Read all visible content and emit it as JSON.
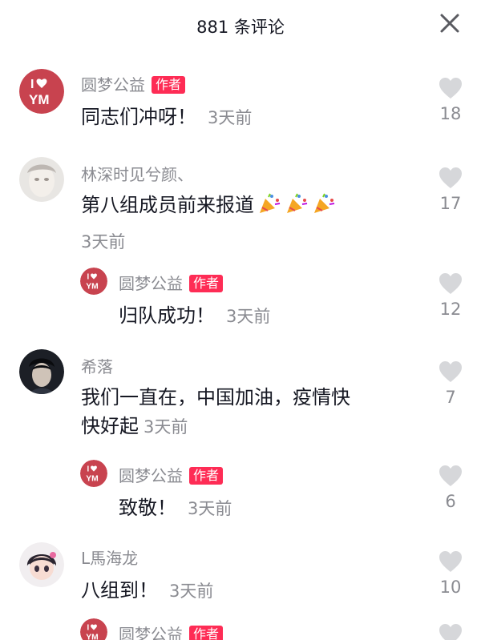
{
  "header": {
    "title": "881 条评论",
    "close_icon": "close-icon"
  },
  "author_tag": "作者",
  "comments": [
    {
      "user": "圆梦公益",
      "is_author": true,
      "text": "同志们冲呀！",
      "time": "3天前",
      "likes": "18"
    },
    {
      "user": "林深时见兮颜、",
      "is_author": false,
      "text": "第八组成员前来报道",
      "emojis": [
        "party-popper-icon",
        "party-popper-icon",
        "party-popper-icon"
      ],
      "time": "3天前",
      "likes": "17",
      "replies": [
        {
          "user": "圆梦公益",
          "is_author": true,
          "text": "归队成功！",
          "time": "3天前",
          "likes": "12"
        }
      ]
    },
    {
      "user": "希落",
      "is_author": false,
      "text_line1": "我们一直在，中国加油，疫情快",
      "text_line2": "快好起",
      "time": "3天前",
      "likes": "7",
      "replies": [
        {
          "user": "圆梦公益",
          "is_author": true,
          "text": "致敬！",
          "time": "3天前",
          "likes": "6"
        }
      ]
    },
    {
      "user": "L馬海龙",
      "is_author": false,
      "text": "八组到！",
      "time": "3天前",
      "likes": "10",
      "replies": [
        {
          "user": "圆梦公益",
          "is_author": true
        }
      ]
    }
  ],
  "colors": {
    "accent": "#fe2c55",
    "muted": "#8a8b91",
    "text": "#161823",
    "heart": "#d6d7da"
  }
}
